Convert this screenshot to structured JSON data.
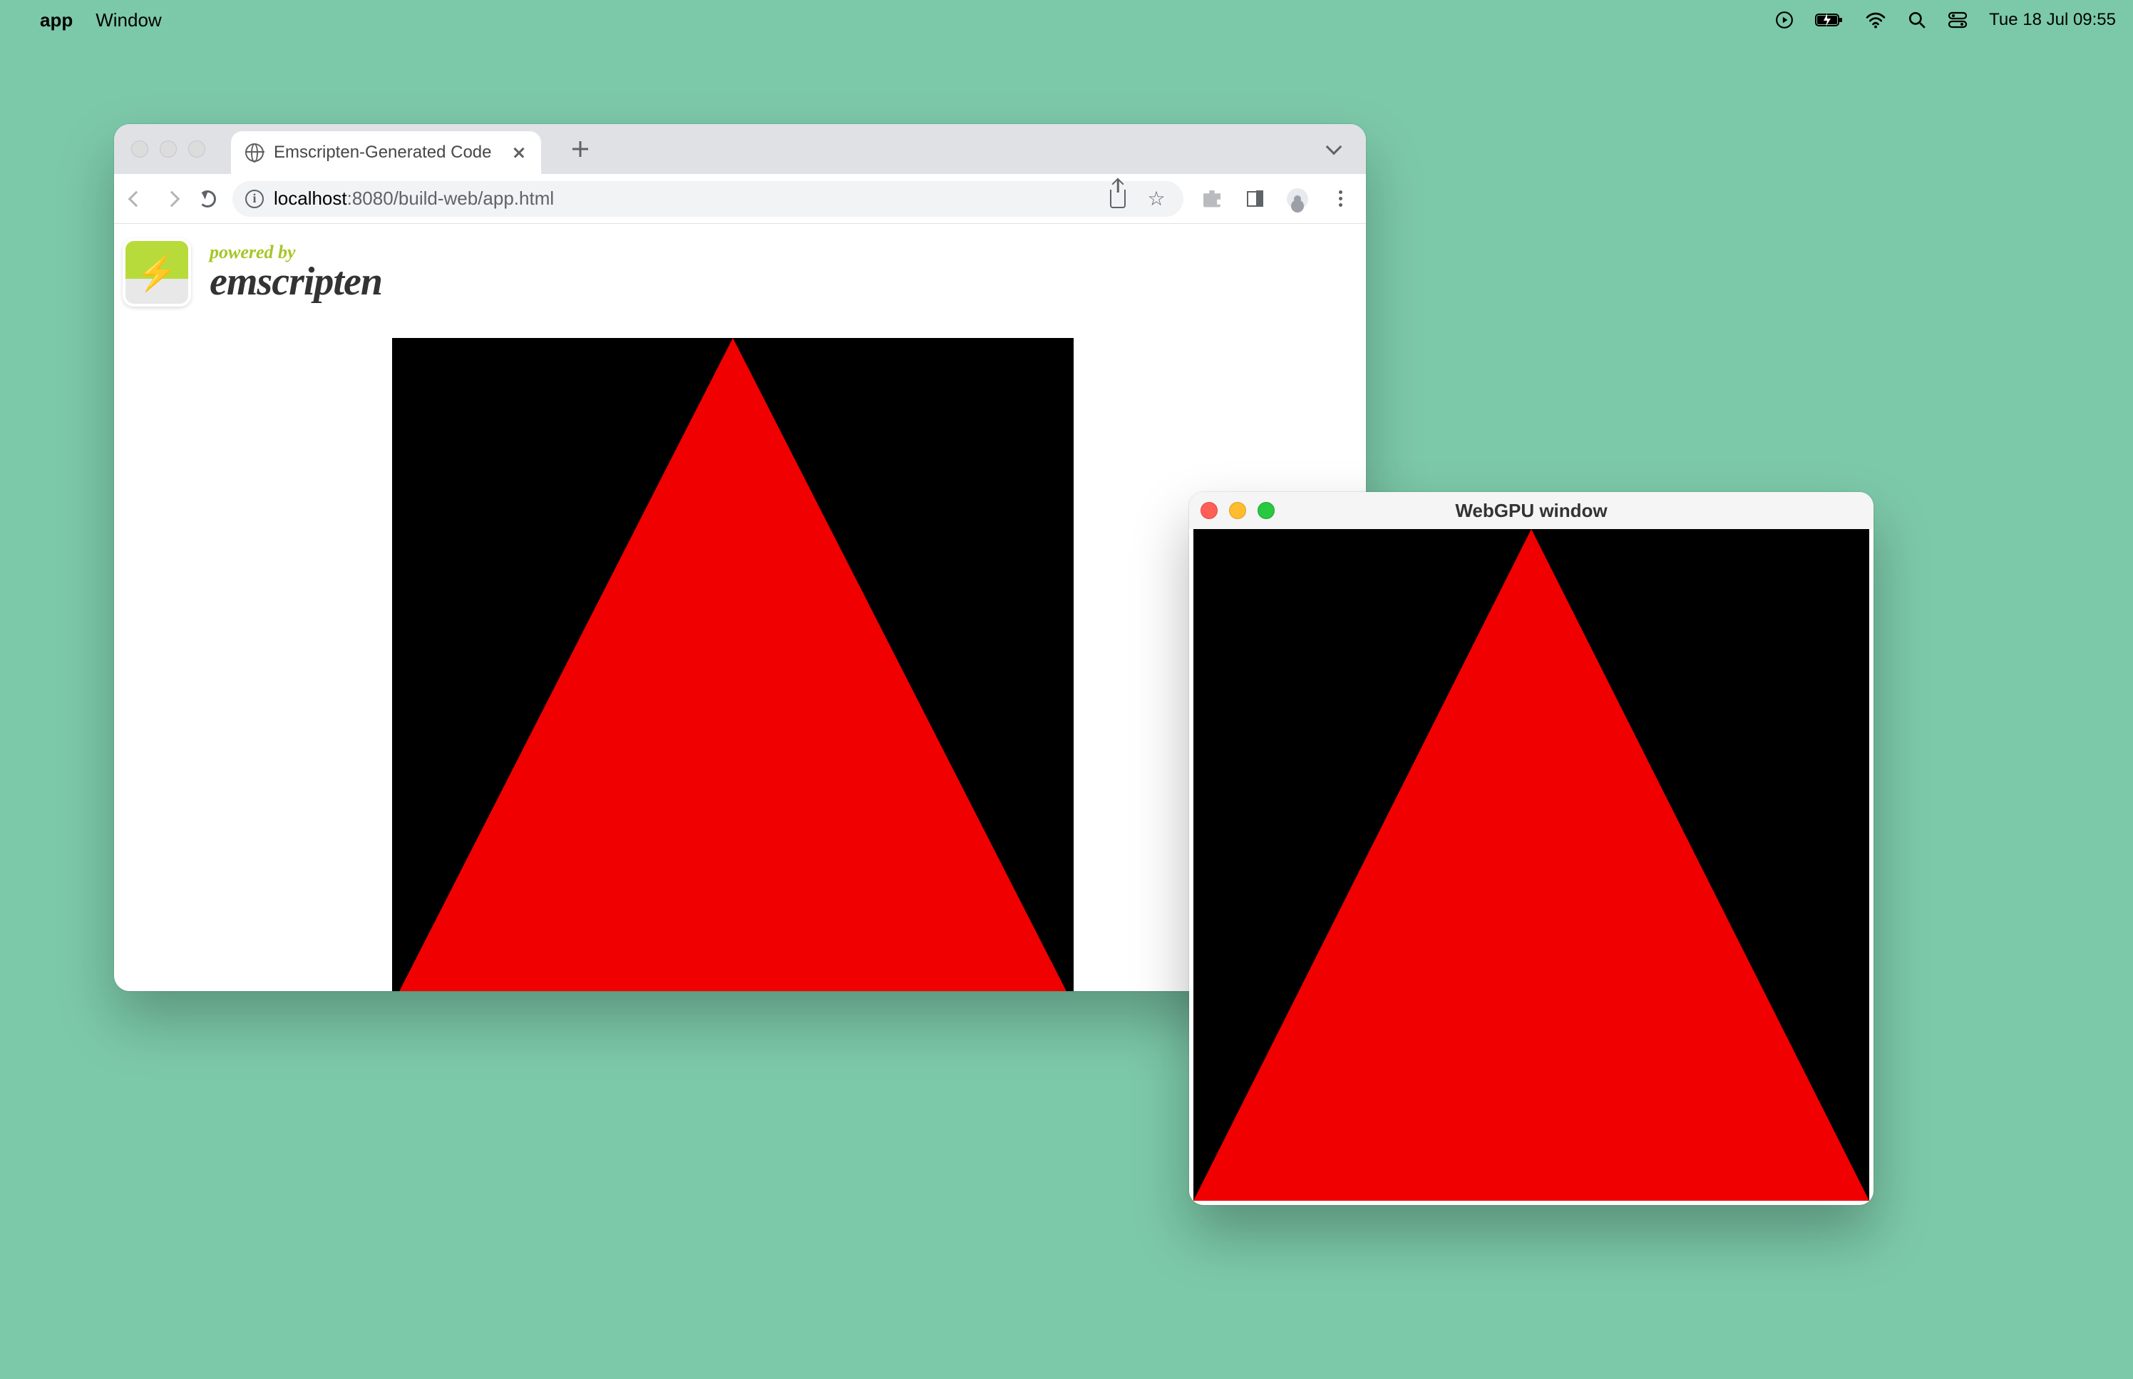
{
  "menubar": {
    "app_name": "app",
    "menus": [
      "Window"
    ],
    "clock": "Tue 18 Jul  09:55"
  },
  "browser": {
    "tab": {
      "title": "Emscripten-Generated Code"
    },
    "url": {
      "host": "localhost",
      "path": ":8080/build-web/app.html"
    },
    "emscripten": {
      "powered": "powered by",
      "brand": "emscripten"
    }
  },
  "native": {
    "title": "WebGPU window"
  },
  "colors": {
    "desktop": "#7cc9a9",
    "canvas_bg": "#000000",
    "triangle": "#f00000"
  }
}
